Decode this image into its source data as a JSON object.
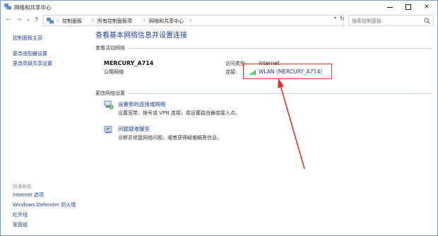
{
  "window": {
    "title": "网络和共享中心"
  },
  "address": {
    "crumbs": [
      "控制面板",
      "所有控制面板项",
      "网络和共享中心"
    ],
    "search_placeholder": "搜索控制面板"
  },
  "sidebar": {
    "links": [
      "控制面板主页",
      "更改适配器设置",
      "更改高级共享设置"
    ],
    "see_also_title": "另请参阅",
    "see_also": [
      "Internet 选项",
      "Windows Defender 防火墙",
      "红外线",
      "家庭组"
    ]
  },
  "main": {
    "title": "查看基本网络信息并设置连接",
    "active_section": "查看活动网络",
    "network": {
      "name": "MERCURY_A714",
      "type": "公用网络",
      "access_label": "访问类型:",
      "access_value": "Internet",
      "connection_label": "连接:",
      "connection_value": "WLAN (MERCURY_A714)"
    },
    "change_section": "更改网络设置",
    "tasks": [
      {
        "title": "设置新的连接或网络",
        "desc": "设置宽带、拨号或 VPN 连接；或设置路由器或接入点。"
      },
      {
        "title": "问题疑难解答",
        "desc": "诊断并修复网络问题，或者获得疑难解答信息。"
      }
    ]
  },
  "colors": {
    "link": "#1a3f8f",
    "title": "#1d3f8f",
    "highlight": "#e0302f",
    "signal": "#3aa13a"
  }
}
